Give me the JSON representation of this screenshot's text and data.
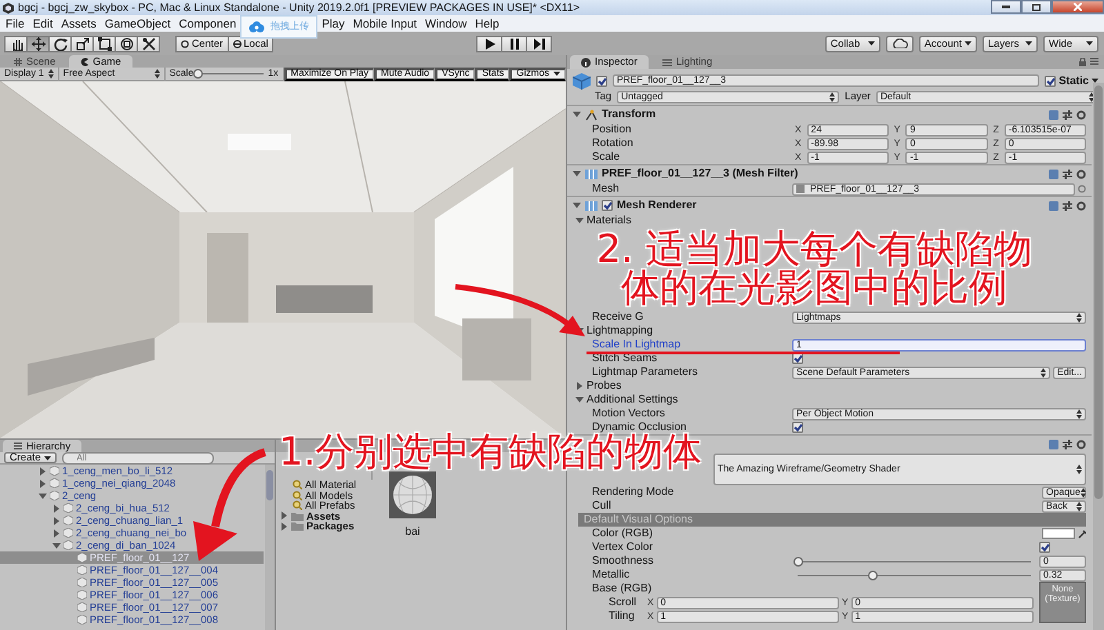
{
  "window": {
    "title": "bgcj - bgcj_zw_skybox - PC, Mac & Linux Standalone - Unity 2019.2.0f1 [PREVIEW PACKAGES IN USE]* <DX11>"
  },
  "menu": [
    {
      "kind": "menu",
      "label": "File"
    },
    {
      "kind": "menu",
      "label": "Edit"
    },
    {
      "kind": "menu",
      "label": "Assets"
    },
    {
      "kind": "menu",
      "label": "GameObject"
    },
    {
      "kind": "menu",
      "label": "Componen"
    },
    {
      "kind": "upload",
      "label": "拖拽上传"
    },
    {
      "kind": "menu",
      "label": "Play"
    },
    {
      "kind": "menu",
      "label": "Mobile Input"
    },
    {
      "kind": "menu",
      "label": "Window"
    },
    {
      "kind": "menu",
      "label": "Help"
    }
  ],
  "toolbar": {
    "tools": [
      {
        "kind": "hand",
        "selected": false
      },
      {
        "kind": "move",
        "selected": true
      },
      {
        "kind": "rotate",
        "selected": false
      },
      {
        "kind": "scale",
        "selected": false
      },
      {
        "kind": "rect",
        "selected": false
      },
      {
        "kind": "transform",
        "selected": false
      },
      {
        "kind": "custom",
        "selected": false
      }
    ],
    "pivot": [
      {
        "kind": "center",
        "label": "Center"
      },
      {
        "kind": "local",
        "label": "Local"
      }
    ],
    "playback": [
      {
        "kind": "play",
        "selected": false
      },
      {
        "kind": "pause",
        "selected": false
      },
      {
        "kind": "step",
        "selected": false
      }
    ],
    "right": [
      {
        "kind": "dropdown",
        "label": "Collab"
      },
      {
        "kind": "cloud"
      },
      {
        "kind": "dropdown",
        "label": "Account"
      },
      {
        "kind": "dropdown",
        "label": "Layers"
      },
      {
        "kind": "dropdown",
        "label": "Wide"
      }
    ]
  },
  "game_panel": {
    "tabs": [
      {
        "label": "Scene",
        "selected": false
      },
      {
        "label": "Game",
        "selected": true
      }
    ],
    "display": "Display 1",
    "aspect": "Free Aspect",
    "scale_label": "Scale",
    "scale": {
      "level": 0,
      "reading": "1x"
    },
    "toggles": [
      "Maximize On Play",
      "Mute Audio",
      "VSync",
      "Stats"
    ],
    "gizmos": "Gizmos",
    "view": {
      "kind": "picture"
    }
  },
  "hierarchy": {
    "title": "Hierarchy",
    "create": "Create",
    "search": {
      "placeholder": "All"
    },
    "items": [
      {
        "label": "1_ceng_men_bo_li_512",
        "expanded": false,
        "selected": false
      },
      {
        "label": "1_ceng_nei_qiang_2048",
        "expanded": false,
        "selected": false
      },
      {
        "label": "2_ceng",
        "expanded": true,
        "selected": false,
        "children": [
          {
            "label": "2_ceng_bi_hua_512",
            "expanded": false,
            "selected": false
          },
          {
            "label": "2_ceng_chuang_lian_1",
            "expanded": false,
            "selected": false
          },
          {
            "label": "2_ceng_chuang_nei_bo",
            "expanded": false,
            "selected": false
          },
          {
            "label": "2_ceng_di_ban_1024",
            "expanded": true,
            "selected": false,
            "children": [
              {
                "label": "PREF_floor_01__127",
                "selected": true
              },
              {
                "label": "PREF_floor_01__127__004",
                "selected": false
              },
              {
                "label": "PREF_floor_01__127__005",
                "selected": false
              },
              {
                "label": "PREF_floor_01__127__006",
                "selected": false
              },
              {
                "label": "PREF_floor_01__127__007",
                "selected": false
              },
              {
                "label": "PREF_floor_01__127__008",
                "selected": false
              }
            ]
          }
        ]
      }
    ]
  },
  "project": {
    "favorites": [
      "All Material",
      "All Models",
      "All Prefabs"
    ],
    "folders": [
      {
        "label": "Assets",
        "expanded": false
      },
      {
        "label": "Packages",
        "expanded": false
      }
    ],
    "assets": [
      {
        "name": "bai"
      }
    ]
  },
  "inspector": {
    "tabs": [
      {
        "label": "Inspector",
        "selected": true
      },
      {
        "label": "Lighting",
        "selected": false
      }
    ],
    "object": {
      "name": "PREF_floor_01__127__3",
      "active": true,
      "static": true,
      "static_label": "Static",
      "tag_label": "Tag",
      "tag": "Untagged",
      "layer_label": "Layer",
      "layer": "Default"
    },
    "rows": [
      {
        "kind": "transform-header",
        "title": "Transform",
        "expanded": true
      },
      {
        "kind": "vector",
        "label": "Position",
        "axes": [
          {
            "axis": "X",
            "value": "24"
          },
          {
            "axis": "Y",
            "value": "9"
          },
          {
            "axis": "Z",
            "value": "-6.103515e-07"
          }
        ]
      },
      {
        "kind": "vector",
        "label": "Rotation",
        "axes": [
          {
            "axis": "X",
            "value": "-89.98"
          },
          {
            "axis": "Y",
            "value": "0"
          },
          {
            "axis": "Z",
            "value": "0"
          }
        ]
      },
      {
        "kind": "vector",
        "label": "Scale",
        "axes": [
          {
            "axis": "X",
            "value": "-1"
          },
          {
            "axis": "Y",
            "value": "-1"
          },
          {
            "axis": "Z",
            "value": "-1"
          }
        ]
      },
      {
        "kind": "component-header",
        "title": "PREF_floor_01__127__3 (Mesh Filter)",
        "expanded": true
      },
      {
        "kind": "object",
        "label": "Mesh",
        "value": "PREF_floor_01__127__3"
      },
      {
        "kind": "component-header",
        "title": "Mesh Renderer",
        "expanded": true,
        "enabled": true
      },
      {
        "kind": "group",
        "label": "Materials",
        "expanded": true
      },
      {
        "kind": "covered"
      },
      {
        "kind": "covered"
      },
      {
        "kind": "covered"
      },
      {
        "kind": "covered"
      },
      {
        "kind": "covered"
      },
      {
        "kind": "covered"
      },
      {
        "kind": "dropdown",
        "label": "Receive G",
        "value": "Lightmaps"
      },
      {
        "kind": "group",
        "label": "Lightmapping",
        "expanded": true
      },
      {
        "kind": "field",
        "label": "Scale In Lightmap",
        "value": "1",
        "focused": true
      },
      {
        "kind": "checkbox",
        "label": "Stitch Seams",
        "checked": true
      },
      {
        "kind": "dropdown",
        "label": "Lightmap Parameters",
        "value": "Scene Default Parameters",
        "button": "Edit..."
      },
      {
        "kind": "group",
        "label": "Probes",
        "expanded": false
      },
      {
        "kind": "group",
        "label": "Additional Settings",
        "expanded": true
      },
      {
        "kind": "dropdown",
        "label": "Motion Vectors",
        "value": "Per Object Motion"
      },
      {
        "kind": "checkbox",
        "label": "Dynamic Occlusion",
        "checked": true
      },
      {
        "kind": "material",
        "shader": "The Amazing Wireframe/Geometry Shader"
      },
      {
        "kind": "mini-dropdown",
        "label": "Rendering Mode",
        "value": "Opaque"
      },
      {
        "kind": "mini-dropdown",
        "label": "Cull",
        "value": "Back"
      },
      {
        "kind": "band",
        "label": "Default Visual Options"
      },
      {
        "kind": "color",
        "label": "Color (RGB)",
        "color": "#ffffff"
      },
      {
        "kind": "right-checkbox",
        "label": "Vertex Color",
        "checked": true
      },
      {
        "kind": "slider",
        "label": "Smoothness",
        "level": 0,
        "reading": "0"
      },
      {
        "kind": "slider",
        "label": "Metallic",
        "level": 0.32,
        "reading": "0.32"
      },
      {
        "kind": "texture",
        "label": "Base (RGB)",
        "texture": "None (Texture)",
        "uv": [
          {
            "label": "Scroll",
            "axes": [
              {
                "axis": "X",
                "value": "0"
              },
              {
                "axis": "Y",
                "value": "0"
              }
            ]
          },
          {
            "label": "Tiling",
            "axes": [
              {
                "axis": "X",
                "value": "1"
              },
              {
                "axis": "Y",
                "value": "1"
              }
            ]
          }
        ]
      }
    ]
  },
  "annotations": [
    {
      "text": "2. 适当加大每个有缺陷物体的在光影图中的比例"
    },
    {
      "text": "1.分别选中有缺陷的物体"
    }
  ]
}
